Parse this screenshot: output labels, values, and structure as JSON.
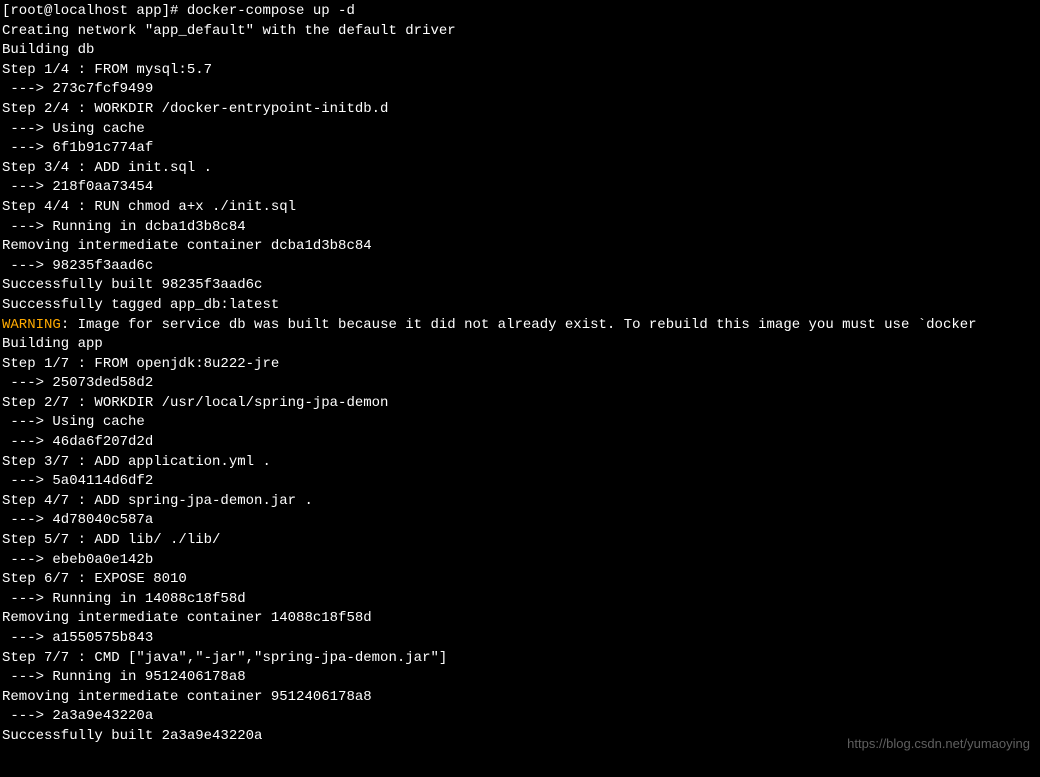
{
  "terminal": {
    "command_line": "[root@localhost app]# docker-compose up -d",
    "lines": [
      "Creating network \"app_default\" with the default driver",
      "Building db",
      "Step 1/4 : FROM mysql:5.7",
      " ---> 273c7fcf9499",
      "Step 2/4 : WORKDIR /docker-entrypoint-initdb.d",
      " ---> Using cache",
      " ---> 6f1b91c774af",
      "Step 3/4 : ADD init.sql .",
      " ---> 218f0aa73454",
      "Step 4/4 : RUN chmod a+x ./init.sql",
      " ---> Running in dcba1d3b8c84",
      "Removing intermediate container dcba1d3b8c84",
      " ---> 98235f3aad6c",
      "",
      "Successfully built 98235f3aad6c",
      "Successfully tagged app_db:latest"
    ],
    "warning_label": "WARNING",
    "warning_text": ": Image for service db was built because it did not already exist. To rebuild this image you must use `docker",
    "lines2": [
      "Building app",
      "Step 1/7 : FROM openjdk:8u222-jre",
      " ---> 25073ded58d2",
      "Step 2/7 : WORKDIR /usr/local/spring-jpa-demon",
      " ---> Using cache",
      " ---> 46da6f207d2d",
      "Step 3/7 : ADD application.yml .",
      " ---> 5a04114d6df2",
      "Step 4/7 : ADD spring-jpa-demon.jar .",
      " ---> 4d78040c587a",
      "Step 5/7 : ADD lib/ ./lib/",
      " ---> ebeb0a0e142b",
      "Step 6/7 : EXPOSE 8010",
      " ---> Running in 14088c18f58d",
      "Removing intermediate container 14088c18f58d",
      " ---> a1550575b843",
      "Step 7/7 : CMD [\"java\",\"-jar\",\"spring-jpa-demon.jar\"]",
      " ---> Running in 9512406178a8",
      "Removing intermediate container 9512406178a8",
      " ---> 2a3a9e43220a",
      "",
      "Successfully built 2a3a9e43220a"
    ]
  },
  "watermark": "https://blog.csdn.net/yumaoying"
}
